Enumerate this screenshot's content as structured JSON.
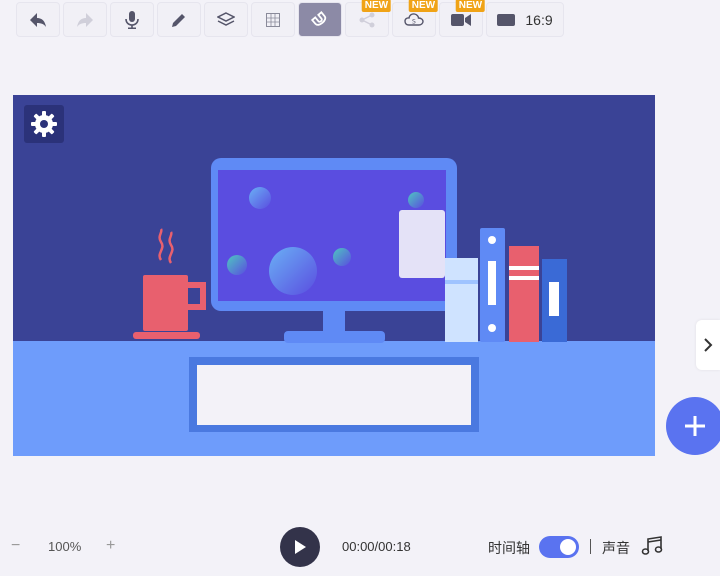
{
  "toolbar": {
    "items": [
      {
        "icon": "undo-icon",
        "state": "normal"
      },
      {
        "icon": "redo-icon",
        "state": "disabled"
      },
      {
        "icon": "microphone-icon",
        "state": "normal"
      },
      {
        "icon": "pencil-icon",
        "state": "normal"
      },
      {
        "icon": "layers-icon",
        "state": "normal"
      },
      {
        "icon": "grid-icon",
        "state": "normal"
      },
      {
        "icon": "magnet-icon",
        "state": "active"
      },
      {
        "icon": "share-nodes-icon",
        "state": "disabled",
        "badge": "NEW"
      },
      {
        "icon": "cloud-subtitle-icon",
        "state": "normal",
        "badge": "NEW"
      },
      {
        "icon": "video-camera-icon",
        "state": "normal",
        "badge": "NEW"
      }
    ],
    "ratio_label": "16:9",
    "badge_new": "NEW"
  },
  "canvas": {
    "background_color": "#3a4396",
    "floor_color": "#6e9cfb"
  },
  "bottom": {
    "zoom_minus": "−",
    "zoom_value": "100%",
    "zoom_plus": "+",
    "time": "00:00/00:18",
    "timeline_label": "时间轴",
    "timeline_on": true,
    "sound_label": "声音"
  },
  "colors": {
    "accent": "#5a73f0",
    "badge": "#f0a316"
  }
}
